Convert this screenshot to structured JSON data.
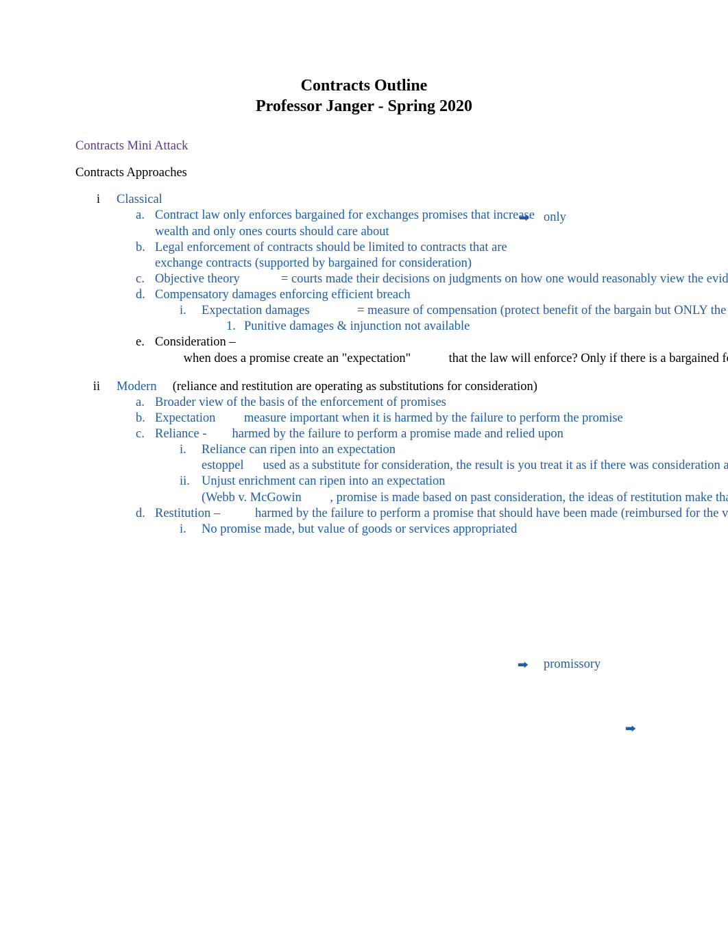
{
  "title": "Contracts Outline",
  "subtitle": "Professor Janger - Spring 2020",
  "mini_attack": "Contracts Mini Attack",
  "approaches_header": "Contracts Approaches",
  "floaters": {
    "only": "only",
    "promissory": "promissory",
    "arrow1": "🠲",
    "arrow2": "🠲",
    "arrow3": "🠲"
  },
  "sections": [
    {
      "marker": "i",
      "heading": "Classical",
      "items": [
        {
          "letter": "a.",
          "spans": [
            {
              "cls": "blue",
              "text": "Contract law only enforces bargained for exchanges"
            },
            {
              "cls": "blue",
              "text": "promises that increase wealth and only ones courts should care about"
            }
          ]
        },
        {
          "letter": "b.",
          "spans": [
            {
              "cls": "blue",
              "text": "Legal enforcement of contracts should be limited to contracts that are exchange contracts (supported by bargained for consideration)"
            }
          ]
        },
        {
          "letter": "c.",
          "spans": [
            {
              "cls": "blue ws",
              "text": "Objective theory             = courts made their decisions on judgments on how one would reasonably view the evidence/actions that occurred"
            }
          ]
        },
        {
          "letter": "d.",
          "spans": [
            {
              "cls": "blue",
              "text": "Compensatory damages enforcing efficient breach"
            }
          ],
          "sub_i": [
            {
              "marker": "i.",
              "spans": [
                {
                  "cls": "blue ws",
                  "text": "Expectation damages               = measure of compensation (protect benefit of the bargain but ONLY the benefit of the bargain)"
                }
              ],
              "sub_1": [
                {
                  "marker": "1.",
                  "spans": [
                    {
                      "cls": "blue",
                      "text": "Punitive damages & injunction not available"
                    }
                  ]
                }
              ]
            }
          ]
        },
        {
          "letter": "e.",
          "spans": [
            {
              "cls": "",
              "text": "Consideration – "
            },
            {
              "cls": "ws",
              "text": "         when does a promise create an \"expectation\"            that the law will enforce? Only if there is a bargained for exchange"
            }
          ]
        }
      ]
    },
    {
      "marker": "ii",
      "heading_pre": "Modern",
      "heading_post": "     (reliance and restitution are operating as substitutions for consideration)",
      "items": [
        {
          "letter": "a.",
          "spans": [
            {
              "cls": "blue",
              "text": "Broader view of the basis of the enforcement of promises"
            }
          ]
        },
        {
          "letter": "b.",
          "spans": [
            {
              "cls": "blue ws",
              "text": "Expectation         measure important when it is harmed by the failure to perform the promise"
            }
          ]
        },
        {
          "letter": "c.",
          "spans": [
            {
              "cls": "blue ws",
              "text": "Reliance -        harmed by the failure to perform a promise made and relied upon"
            }
          ],
          "sub_i": [
            {
              "marker": "i.",
              "spans": [
                {
                  "cls": "blue",
                  "text": "Reliance can ripen into an expectation"
                },
                {
                  "cls": "blue ws",
                  "text": "estoppel      used as a substitute for consideration, the result is you treat it as if there was consideration and give expectation damages"
                }
              ]
            },
            {
              "marker": "ii.",
              "spans": [
                {
                  "cls": "blue",
                  "text": "Unjust enrichment can ripen into an expectation"
                },
                {
                  "cls": "blue ws",
                  "text": "(Webb v. McGowin         , promise is made based on past consideration, the ideas of restitution make that promise enforceable on its own terms)"
                }
              ]
            }
          ]
        },
        {
          "letter": "d.",
          "spans": [
            {
              "cls": "blue ws",
              "text": "Restitution –           harmed by the failure to perform a promise that should have been made (reimbursed for the value given)"
            }
          ],
          "sub_i": [
            {
              "marker": "i.",
              "spans": [
                {
                  "cls": "blue",
                  "text": "No promise made, but value of goods or services appropriated"
                }
              ]
            }
          ]
        }
      ]
    }
  ]
}
